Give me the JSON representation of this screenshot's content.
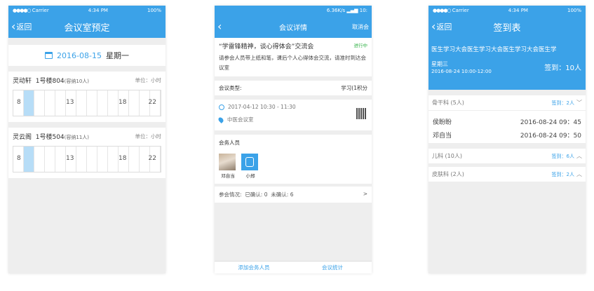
{
  "colors": {
    "accent": "#3ba2e8",
    "status_green": "#35b34a",
    "busy": "#b7ddf7"
  },
  "screen1": {
    "status": {
      "carrier": "Carrier",
      "time": "4:34 PM",
      "battery": "100%"
    },
    "nav": {
      "back": "返回",
      "title": "会议室预定"
    },
    "date": "2016-08-15",
    "weekday": "星期一",
    "rooms": [
      {
        "name": "灵动轩",
        "building": "1号楼804",
        "capacity": "(容纳10人)",
        "unit": "单位：小时",
        "ticks": [
          "8",
          "13",
          "18",
          "22"
        ],
        "busy_hours": [
          9
        ]
      },
      {
        "name": "灵云阁",
        "building": "1号楼504",
        "capacity": "(容纳11人)",
        "unit": "单位：小时",
        "ticks": [
          "8",
          "13",
          "18",
          "22"
        ],
        "busy_hours": [
          9
        ]
      }
    ]
  },
  "screen2": {
    "status": {
      "network": "6.36K/s",
      "time": "10:"
    },
    "nav": {
      "title": "会议详情",
      "right": "取消会"
    },
    "meeting_title": "“学雷锋精神，谈心得体会”交流会",
    "status_label": "进行中",
    "description": "请参会人员带上纸和笔，课后个人心得体会交流，请准时到达会议室",
    "type_label": "会议类型:",
    "type_value": "学习(1积分",
    "time": "2017-04-12 10:30 - 11:30",
    "location": "中医会议室",
    "members_label": "会务人员",
    "members": [
      {
        "name": "邓自当"
      },
      {
        "name": "小郑"
      }
    ],
    "attendance": {
      "label": "参会情况:",
      "confirmed": "已确认: 0",
      "unconfirmed": "未确认: 6",
      "arrow": ">"
    },
    "bottom": {
      "add": "添加会务人员",
      "stats": "会议统计"
    }
  },
  "screen3": {
    "status": {
      "carrier": "Carrier",
      "time": "4:34 PM",
      "battery": "100%"
    },
    "nav": {
      "back": "返回",
      "title": "签到表"
    },
    "meeting_title": "医生学习大会医生学习大会医生学习大会医生学",
    "weekday": "星期三",
    "datetime": "2016-08-24  10:00-12:00",
    "signed": "签到：10人",
    "departments": [
      {
        "name": "骨干科 (5人)",
        "signed": "签到：2人",
        "arrow": "﹀",
        "people": [
          {
            "name": "侯盼盼",
            "time": "2016-08-24  09：45"
          },
          {
            "name": "邓自当",
            "time": "2016-08-24  09：50"
          }
        ]
      },
      {
        "name": "儿科 (10人)",
        "signed": "签到：6人",
        "arrow": "︿",
        "people": []
      },
      {
        "name": "皮肤科 (2人)",
        "signed": "签到：2人",
        "arrow": "︿",
        "people": []
      }
    ]
  }
}
